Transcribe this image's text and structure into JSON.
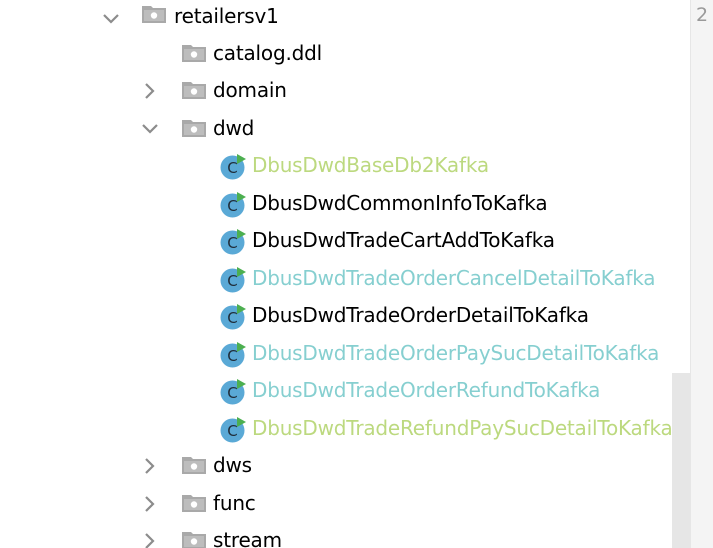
{
  "tree": {
    "root": {
      "label": "retailersv1",
      "expanded": true
    },
    "children": [
      {
        "label": "catalog.ddl",
        "type": "file"
      },
      {
        "label": "domain",
        "type": "folder",
        "expanded": false
      },
      {
        "label": "dwd",
        "type": "folder",
        "expanded": true
      }
    ],
    "dwd_classes": [
      {
        "label": "DbusDwdBaseDb2Kafka",
        "status_color": "#bcd97f"
      },
      {
        "label": "DbusDwdCommonInfoToKafka",
        "status_color": "#000000"
      },
      {
        "label": "DbusDwdTradeCartAddToKafka",
        "status_color": "#000000"
      },
      {
        "label": "DbusDwdTradeOrderCancelDetailToKafka",
        "status_color": "#86cfd0"
      },
      {
        "label": "DbusDwdTradeOrderDetailToKafka",
        "status_color": "#000000"
      },
      {
        "label": "DbusDwdTradeOrderPaySucDetailToKafka",
        "status_color": "#86cfd0"
      },
      {
        "label": "DbusDwdTradeOrderRefundToKafka",
        "status_color": "#86cfd0"
      },
      {
        "label": "DbusDwdTradeRefundPaySucDetailToKafka",
        "status_color": "#bcd97f"
      }
    ],
    "after": [
      {
        "label": "dws",
        "type": "folder",
        "expanded": false
      },
      {
        "label": "func",
        "type": "folder",
        "expanded": false
      },
      {
        "label": "stream",
        "type": "folder",
        "expanded": false
      }
    ]
  },
  "gutter": {
    "line_number": "2"
  },
  "icons": {
    "chevron": "chevron-icon",
    "folder": "folder-icon",
    "class": "java-class-icon"
  },
  "colors": {
    "icon_gray": "#8c8c8c",
    "class_icon_blue": "#5aa9d6",
    "run_badge_green": "#4caf50"
  }
}
